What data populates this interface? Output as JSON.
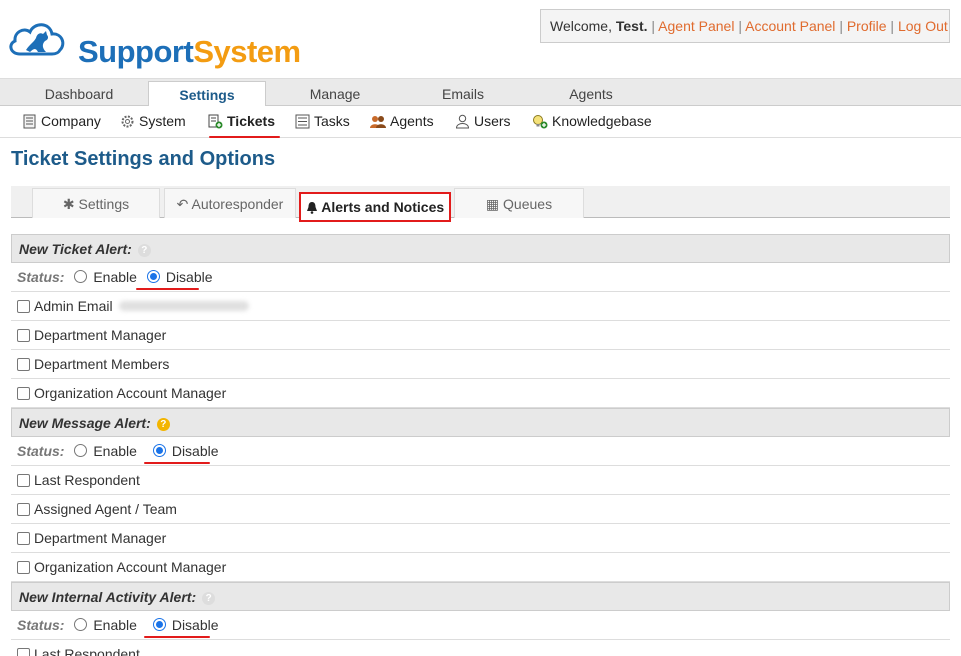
{
  "logo": {
    "part1": "Support",
    "part2": "System"
  },
  "welcome": {
    "greeting": "Welcome, ",
    "user": "Test.",
    "links": [
      "Agent Panel",
      "Account Panel",
      "Profile",
      "Log Out"
    ]
  },
  "nav": {
    "tabs": [
      "Dashboard",
      "Settings",
      "Manage",
      "Emails",
      "Agents"
    ],
    "active": "Settings"
  },
  "subnav": {
    "items": [
      "Company",
      "System",
      "Tickets",
      "Tasks",
      "Agents",
      "Users",
      "Knowledgebase"
    ],
    "active": "Tickets"
  },
  "page_title": "Ticket Settings and Options",
  "tabs": {
    "items": [
      "Settings",
      "Autoresponder",
      "Alerts and Notices",
      "Queues"
    ],
    "active": "Alerts and Notices"
  },
  "sections": {
    "new_ticket": {
      "title": "New Ticket Alert:",
      "status_label": "Status:",
      "enable": "Enable",
      "disable": "Disable",
      "options": [
        "Admin Email",
        "Department Manager",
        "Department Members",
        "Organization Account Manager"
      ]
    },
    "new_message": {
      "title": "New Message Alert:",
      "status_label": "Status:",
      "enable": "Enable",
      "disable": "Disable",
      "options": [
        "Last Respondent",
        "Assigned Agent / Team",
        "Department Manager",
        "Organization Account Manager"
      ]
    },
    "new_internal": {
      "title": "New Internal Activity Alert:",
      "status_label": "Status:",
      "enable": "Enable",
      "disable": "Disable",
      "options": [
        "Last Respondent"
      ]
    }
  },
  "colors": {
    "brand_blue": "#1d6fb8",
    "brand_orange": "#f39c12",
    "highlight_red": "#e21b1b",
    "link_orange": "#e06b2e"
  }
}
